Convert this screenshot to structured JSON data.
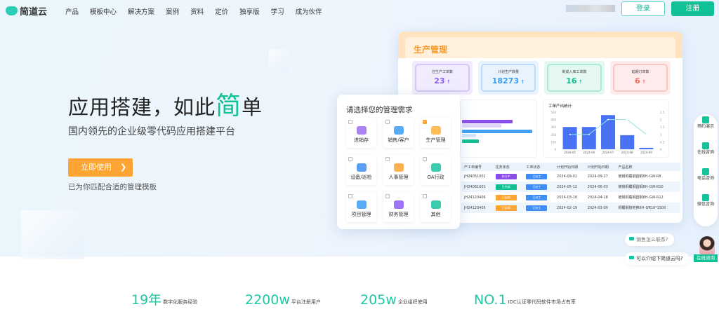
{
  "nav": {
    "brand": "简道云",
    "items": [
      "产品",
      "模板中心",
      "解决方案",
      "案例",
      "资料",
      "定价",
      "独享版",
      "学习",
      "成为伙伴"
    ],
    "login": "登录",
    "register": "注册"
  },
  "hero": {
    "title_a": "应用搭建，如此",
    "title_hl": "简",
    "title_b": "单",
    "subtitle": "国内领先的企业级零代码应用搭建平台",
    "cta": "立即使用",
    "cta_icon": "chevron-right",
    "hint": "已为你匹配合适的管理模板"
  },
  "dashboard": {
    "title": "生产管理",
    "kpis": [
      {
        "label": "在生产工单数",
        "value": "23",
        "color": "#8a5cf6"
      },
      {
        "label": "计划生产数量",
        "value": "18273",
        "color": "#3d9cf5"
      },
      {
        "label": "制成入库工单数",
        "value": "16",
        "color": "#12bf90"
      },
      {
        "label": "延期订单数",
        "value": "6",
        "color": "#f86a5a"
      }
    ],
    "chart": {
      "title": "工单产出统计",
      "categories": [
        "2024-05",
        "2024-06",
        "2024-07",
        "2024-08",
        "2024-09"
      ],
      "bars": [
        300,
        300,
        460,
        190,
        20
      ],
      "line": [
        1,
        1,
        2,
        2,
        1
      ],
      "y_left": [
        "500",
        "400",
        "300",
        "200",
        "100",
        "0"
      ],
      "y_right": [
        "2.5",
        "2",
        "1.5",
        "1",
        "0.5",
        "0"
      ],
      "ylim": [
        0,
        500
      ],
      "y2lim": [
        0,
        2.5
      ]
    },
    "table": {
      "headers": [
        "产工单编号",
        "任务状态",
        "工单状态",
        "计划开始日期",
        "计划开始日期",
        "产品名称"
      ],
      "rows": [
        [
          "JH24051001",
          "执行中",
          "已派工",
          "2024-09-01",
          "2024-09-27",
          "镀锡铜覆钢圆钢8H-GW-R8"
        ],
        [
          "JH24061001",
          "已完成",
          "已派工",
          "2024-05-12",
          "2024-06-03",
          "镀锡铜覆钢圆钢8H-GW-R10"
        ],
        [
          "JH24120406",
          "已延期",
          "已派工",
          "2024-03-18",
          "2024-04-18",
          "镀锡铜覆钢圆钢8H-GW-R12"
        ],
        [
          "JH24120405",
          "已延期",
          "已派工",
          "2024-02-19",
          "2024-03-09",
          "铜覆钢接地棒8H-GR16*1500"
        ]
      ],
      "status_colors": {
        "执行中": "#8a4ce8",
        "已完成": "#12bf90",
        "已延期": "#fda432",
        "已派工": "#3d8df5"
      }
    }
  },
  "selector": {
    "title": "请选择您的管理需求",
    "options": [
      {
        "label": "进销存",
        "checked": false,
        "color": "#9b6cf0"
      },
      {
        "label": "销售/客户",
        "checked": false,
        "color": "#3d9cf5"
      },
      {
        "label": "生产管理",
        "checked": true,
        "color": "#fdb13a"
      },
      {
        "label": "设备/巡检",
        "checked": false,
        "color": "#3d8df5"
      },
      {
        "label": "人事管理",
        "checked": false,
        "color": "#fda432"
      },
      {
        "label": "OA行政",
        "checked": false,
        "color": "#18c3a0"
      },
      {
        "label": "项目管理",
        "checked": false,
        "color": "#3d9cf5"
      },
      {
        "label": "财务管理",
        "checked": false,
        "color": "#8a5cf6"
      },
      {
        "label": "其他",
        "checked": false,
        "color": "#18c3a0"
      }
    ]
  },
  "float": [
    "预约演示",
    "在线咨询",
    "电话咨询",
    "微信咨询"
  ],
  "chat": {
    "q1": "销售怎么联系?",
    "q2": "可以介绍下简道云吗?",
    "online": "在线咨询"
  },
  "stats": [
    {
      "n": "19年",
      "l": "数字化服务经验"
    },
    {
      "n": "2200w",
      "l": "平台注册用户"
    },
    {
      "n": "205w",
      "l": "企业组织使用"
    },
    {
      "n": "NO.1",
      "l": "IDC认证零代码软件市场占有率"
    }
  ]
}
